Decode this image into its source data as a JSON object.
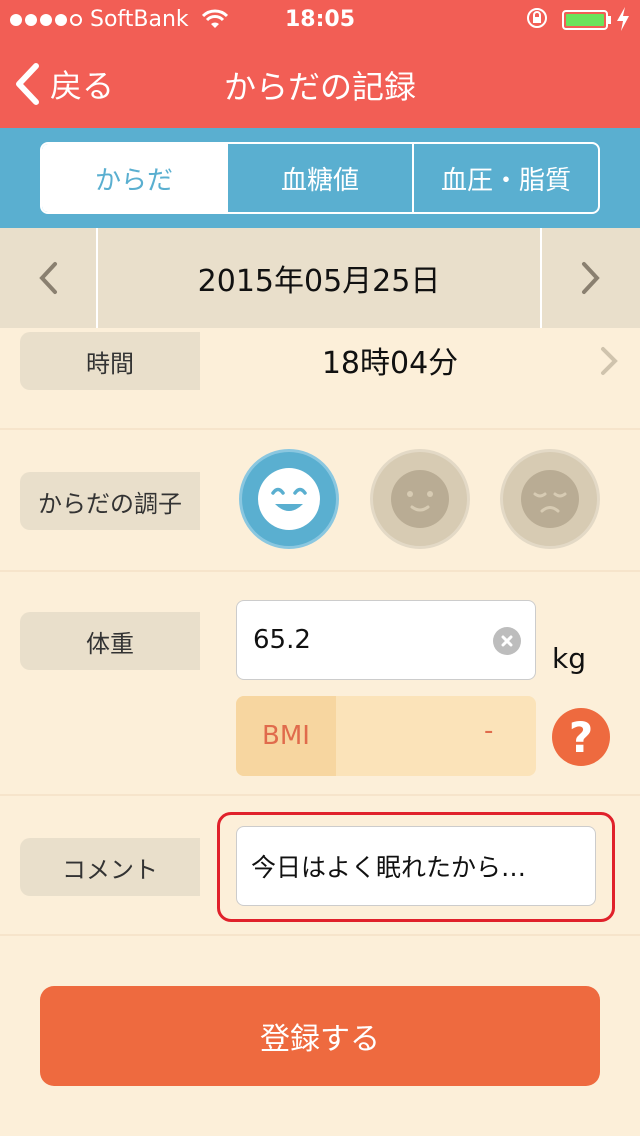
{
  "status_bar": {
    "carrier": "SoftBank",
    "time": "18:05"
  },
  "nav": {
    "back_label": "戻る",
    "title": "からだの記録"
  },
  "tabs": [
    {
      "label": "からだ",
      "active": true
    },
    {
      "label": "血糖値",
      "active": false
    },
    {
      "label": "血圧・脂質",
      "active": false
    }
  ],
  "date": {
    "value": "2015年05月25日"
  },
  "time_row": {
    "label": "時間",
    "value": "18時04分"
  },
  "condition_row": {
    "label": "からだの調子",
    "selected": "good"
  },
  "weight_row": {
    "label": "体重",
    "value": "65.2",
    "unit": "kg"
  },
  "bmi": {
    "label": "BMI",
    "value": "-"
  },
  "comment_row": {
    "label": "コメント",
    "value": "今日はよく眠れたから…"
  },
  "submit_label": "登録する",
  "colors": {
    "header": "#f25e55",
    "segment_bar": "#5aafd0",
    "accent": "#ee6a3f",
    "background": "#fcefd9"
  }
}
